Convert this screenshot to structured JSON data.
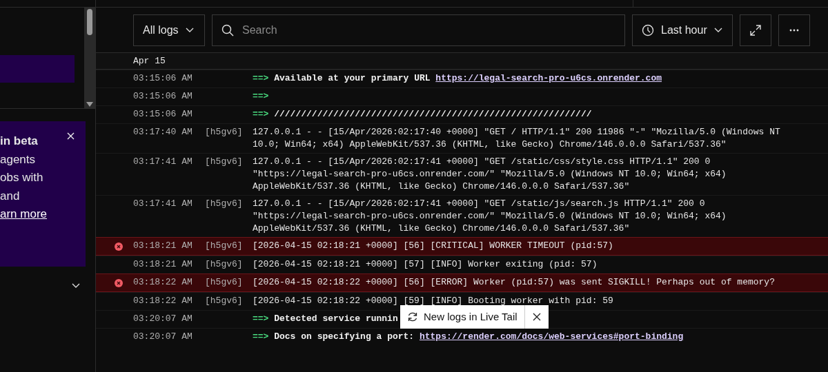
{
  "sidebar": {
    "promo": {
      "title": "in beta",
      "lines": [
        "agents",
        "obs with",
        "and"
      ],
      "link": "arn more"
    }
  },
  "toolbar": {
    "filter": "All logs",
    "search": {
      "placeholder": "Search"
    },
    "range": "Last hour"
  },
  "date_header": "Apr 15",
  "logs": [
    {
      "time": "03:15:06 AM",
      "error": false,
      "arrow": "==>",
      "message": "Available at your primary URL ",
      "link": "https://legal-search-pro-u6cs.onrender.com"
    },
    {
      "time": "03:15:06 AM",
      "error": false,
      "arrow": "==>"
    },
    {
      "time": "03:15:06 AM",
      "error": false,
      "arrow": "==>",
      "message": "///////////////////////////////////////////////////////////"
    },
    {
      "time": "03:17:40 AM",
      "instance": "[h5gv6]",
      "error": false,
      "message": "127.0.0.1 - - [15/Apr/2026:02:17:40 +0000] \"GET / HTTP/1.1\" 200 11986 \"-\" \"Mozilla/5.0 (Windows NT 10.0; Win64; x64) AppleWebKit/537.36 (KHTML, like Gecko) Chrome/146.0.0.0 Safari/537.36\""
    },
    {
      "time": "03:17:41 AM",
      "instance": "[h5gv6]",
      "error": false,
      "message": "127.0.0.1 - - [15/Apr/2026:02:17:41 +0000] \"GET /static/css/style.css HTTP/1.1\" 200 0 \"https://legal-search-pro-u6cs.onrender.com/\" \"Mozilla/5.0 (Windows NT 10.0; Win64; x64) AppleWebKit/537.36 (KHTML, like Gecko) Chrome/146.0.0.0 Safari/537.36\""
    },
    {
      "time": "03:17:41 AM",
      "instance": "[h5gv6]",
      "error": false,
      "message": "127.0.0.1 - - [15/Apr/2026:02:17:41 +0000] \"GET /static/js/search.js HTTP/1.1\" 200 0 \"https://legal-search-pro-u6cs.onrender.com/\" \"Mozilla/5.0 (Windows NT 10.0; Win64; x64) AppleWebKit/537.36 (KHTML, like Gecko) Chrome/146.0.0.0 Safari/537.36\""
    },
    {
      "time": "03:18:21 AM",
      "instance": "[h5gv6]",
      "error": true,
      "message": "[2026-04-15 02:18:21 +0000] [56] [CRITICAL] WORKER TIMEOUT (pid:57)"
    },
    {
      "time": "03:18:21 AM",
      "instance": "[h5gv6]",
      "error": false,
      "message": "[2026-04-15 02:18:21 +0000] [57] [INFO] Worker exiting (pid: 57)"
    },
    {
      "time": "03:18:22 AM",
      "instance": "[h5gv6]",
      "error": true,
      "message": "[2026-04-15 02:18:22 +0000] [56] [ERROR] Worker (pid:57) was sent SIGKILL! Perhaps out of memory?"
    },
    {
      "time": "03:18:22 AM",
      "instance": "[h5gv6]",
      "error": false,
      "message": "[2026-04-15 02:18:22 +0000] [59] [INFO] Booting worker with pid: 59"
    },
    {
      "time": "03:20:07 AM",
      "error": false,
      "arrow": "==>",
      "message": "Detected service runnin"
    },
    {
      "time": "03:20:07 AM",
      "error": false,
      "arrow": "==>",
      "message": "Docs on specifying a port: ",
      "link": "https://render.com/docs/web-services#port-binding"
    }
  ],
  "toast": {
    "text": "New logs in Live Tail"
  }
}
